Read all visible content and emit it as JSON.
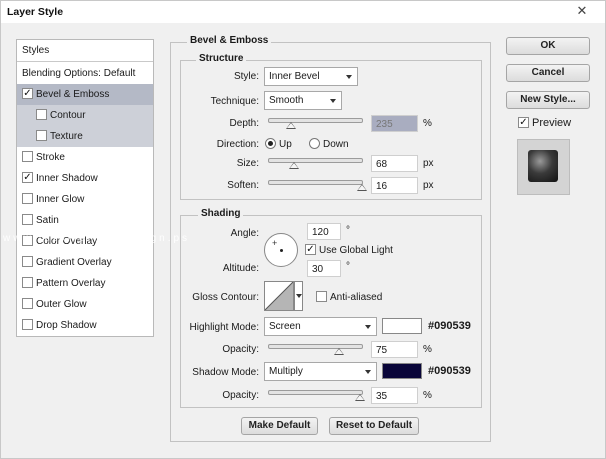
{
  "window": {
    "title": "Layer Style",
    "close_glyph": "✕"
  },
  "styles_panel": {
    "header": "Styles",
    "items": [
      {
        "label": "Blending Options: Default",
        "checkbox": false,
        "checked": false
      },
      {
        "label": "Bevel & Emboss",
        "checkbox": true,
        "checked": true,
        "selected": true
      },
      {
        "label": "Contour",
        "checkbox": true,
        "checked": false,
        "sub": true
      },
      {
        "label": "Texture",
        "checkbox": true,
        "checked": false,
        "sub": true
      },
      {
        "label": "Stroke",
        "checkbox": true,
        "checked": false
      },
      {
        "label": "Inner Shadow",
        "checkbox": true,
        "checked": true
      },
      {
        "label": "Inner Glow",
        "checkbox": true,
        "checked": false
      },
      {
        "label": "Satin",
        "checkbox": true,
        "checked": false
      },
      {
        "label": "Color Overlay",
        "checkbox": true,
        "checked": false
      },
      {
        "label": "Gradient Overlay",
        "checkbox": true,
        "checked": false
      },
      {
        "label": "Pattern Overlay",
        "checkbox": true,
        "checked": false
      },
      {
        "label": "Outer Glow",
        "checkbox": true,
        "checked": false
      },
      {
        "label": "Drop Shadow",
        "checkbox": true,
        "checked": false
      }
    ]
  },
  "bevel": {
    "group_title": "Bevel & Emboss",
    "structure_title": "Structure",
    "style_label": "Style:",
    "style_value": "Inner Bevel",
    "technique_label": "Technique:",
    "technique_value": "Smooth",
    "depth_label": "Depth:",
    "depth_value": "235",
    "depth_unit": "%",
    "depth_level": 0.24,
    "direction_label": "Direction:",
    "direction_up": "Up",
    "direction_down": "Down",
    "direction_selected": "Up",
    "size_label": "Size:",
    "size_value": "68",
    "size_unit": "px",
    "size_level": 0.27,
    "soften_label": "Soften:",
    "soften_value": "16",
    "soften_unit": "px",
    "soften_level": 1.0
  },
  "shading": {
    "title": "Shading",
    "angle_label": "Angle:",
    "angle_value": "120",
    "angle_unit": "°",
    "use_global_light": "Use Global Light",
    "use_global_light_checked": true,
    "altitude_label": "Altitude:",
    "altitude_value": "30",
    "altitude_unit": "°",
    "gloss_contour_label": "Gloss Contour:",
    "anti_aliased": "Anti-aliased",
    "anti_aliased_checked": false,
    "highlight_mode_label": "Highlight Mode:",
    "highlight_mode_value": "Screen",
    "highlight_color": "#ffffff",
    "highlight_hex": "#090539",
    "highlight_opacity_label": "Opacity:",
    "highlight_opacity_value": "75",
    "highlight_opacity_unit": "%",
    "highlight_opacity_level": 0.75,
    "shadow_mode_label": "Shadow Mode:",
    "shadow_mode_value": "Multiply",
    "shadow_color": "#090539",
    "shadow_hex": "#090539",
    "shadow_opacity_label": "Opacity:",
    "shadow_opacity_value": "35",
    "shadow_opacity_unit": "%",
    "shadow_opacity_level": 0.98
  },
  "buttons": {
    "make_default": "Make Default",
    "reset_to_default": "Reset to Default",
    "ok": "OK",
    "cancel": "Cancel",
    "new_style": "New Style..."
  },
  "preview": {
    "label": "Preview",
    "checked": true
  },
  "watermark": "www.tutorialwebdesign.ps"
}
